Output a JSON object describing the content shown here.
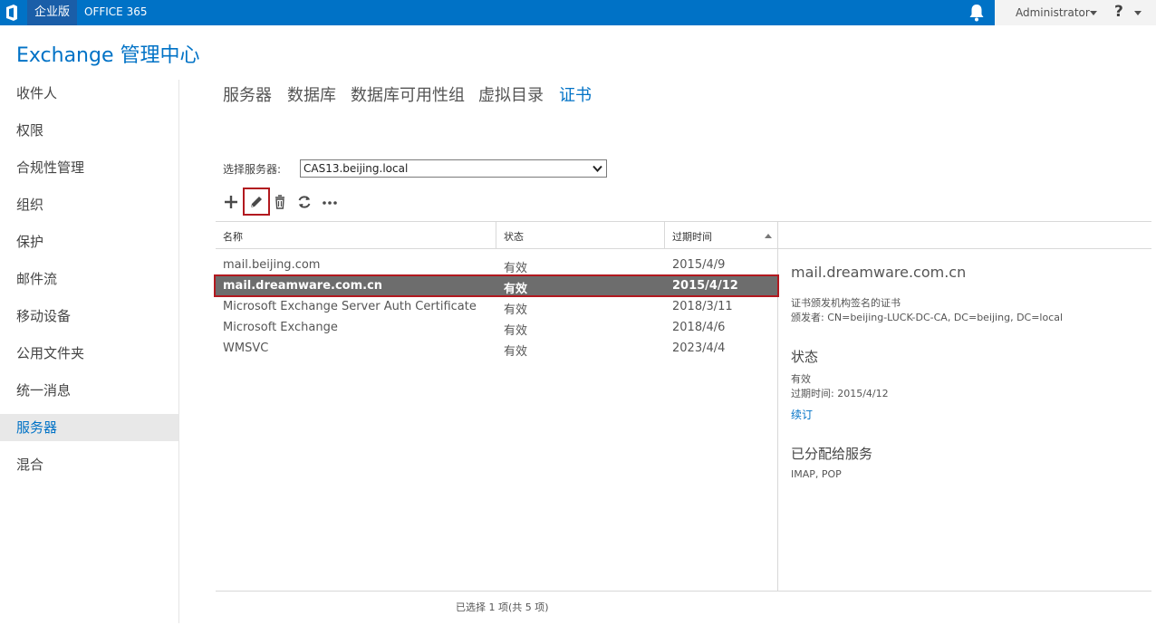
{
  "header": {
    "logo_icon": "office-logo-icon",
    "edition": "企业版",
    "product": "OFFICE 365",
    "user": "Administrator",
    "help": "?",
    "colors": {
      "bar": "#0072c6",
      "accent": "#0072c6",
      "highlight_border": "#b2191f",
      "selected_row": "#6d6d6d"
    }
  },
  "app": {
    "title": "Exchange 管理中心"
  },
  "nav": {
    "items": [
      {
        "label": "收件人"
      },
      {
        "label": "权限"
      },
      {
        "label": "合规性管理"
      },
      {
        "label": "组织"
      },
      {
        "label": "保护"
      },
      {
        "label": "邮件流"
      },
      {
        "label": "移动设备"
      },
      {
        "label": "公用文件夹"
      },
      {
        "label": "统一消息"
      },
      {
        "label": "服务器",
        "active": true
      },
      {
        "label": "混合"
      }
    ]
  },
  "tabs": [
    {
      "label": "服务器"
    },
    {
      "label": "数据库"
    },
    {
      "label": "数据库可用性组"
    },
    {
      "label": "虚拟目录"
    },
    {
      "label": "证书",
      "active": true
    }
  ],
  "server_selector": {
    "label": "选择服务器:",
    "value": "CAS13.beijing.local"
  },
  "toolbar": {
    "icons": [
      "add-icon",
      "edit-icon",
      "delete-icon",
      "refresh-icon",
      "more-icon"
    ]
  },
  "table": {
    "columns": [
      "名称",
      "状态",
      "过期时间"
    ],
    "sorted_column": "过期时间",
    "rows": [
      {
        "name": "mail.beijing.com",
        "status": "有效",
        "expires": "2015/4/9"
      },
      {
        "name": "mail.dreamware.com.cn",
        "status": "有效",
        "expires": "2015/4/12",
        "selected": true
      },
      {
        "name": "Microsoft Exchange Server Auth Certificate",
        "status": "有效",
        "expires": "2018/3/11"
      },
      {
        "name": "Microsoft Exchange",
        "status": "有效",
        "expires": "2018/4/6"
      },
      {
        "name": "WMSVC",
        "status": "有效",
        "expires": "2023/4/4"
      }
    ],
    "footer": "已选择 1 项(共 5 项)"
  },
  "details": {
    "title": "mail.dreamware.com.cn",
    "type": "证书颁发机构签名的证书",
    "issuer": "颁发者: CN=beijing-LUCK-DC-CA, DC=beijing, DC=local",
    "status_heading": "状态",
    "status_value": "有效",
    "expiry": "过期时间: 2015/4/12",
    "renew_link": "续订",
    "services_heading": "已分配给服务",
    "services": "IMAP, POP"
  }
}
